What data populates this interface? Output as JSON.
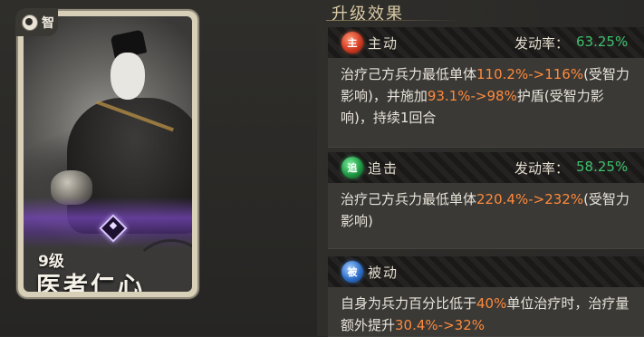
{
  "card": {
    "badge_text": "智",
    "level": "9级",
    "name": "医者仁心"
  },
  "panel": {
    "title": "升级效果",
    "effects": [
      {
        "icon_char": "主",
        "icon_color": "#d23b22",
        "type": "主动",
        "rate_label": "发动率：",
        "rate_value": "63.25%",
        "desc": [
          {
            "t": "治疗己方兵力最低单体",
            "hl": false
          },
          {
            "t": "110.2%->116%",
            "hl": true
          },
          {
            "t": "(受智力影响)，并施加",
            "hl": false
          },
          {
            "t": "93.1%->98%",
            "hl": true
          },
          {
            "t": "护盾(受智力影响)，持续1回合",
            "hl": false
          }
        ]
      },
      {
        "icon_char": "追",
        "icon_color": "#1f9a44",
        "type": "追击",
        "rate_label": "发动率：",
        "rate_value": "58.25%",
        "desc": [
          {
            "t": "治疗己方兵力最低单体",
            "hl": false
          },
          {
            "t": "220.4%->232%",
            "hl": true
          },
          {
            "t": "(受智力影响)",
            "hl": false
          }
        ]
      },
      {
        "icon_char": "被",
        "icon_color": "#2e6fc9",
        "type": "被动",
        "rate_label": "",
        "rate_value": "",
        "desc": [
          {
            "t": "自身为兵力百分比低于",
            "hl": false
          },
          {
            "t": "40%",
            "hl": true
          },
          {
            "t": "单位治疗时，治疗量额外提升",
            "hl": false
          },
          {
            "t": "30.4%->32%",
            "hl": true
          }
        ]
      }
    ]
  }
}
